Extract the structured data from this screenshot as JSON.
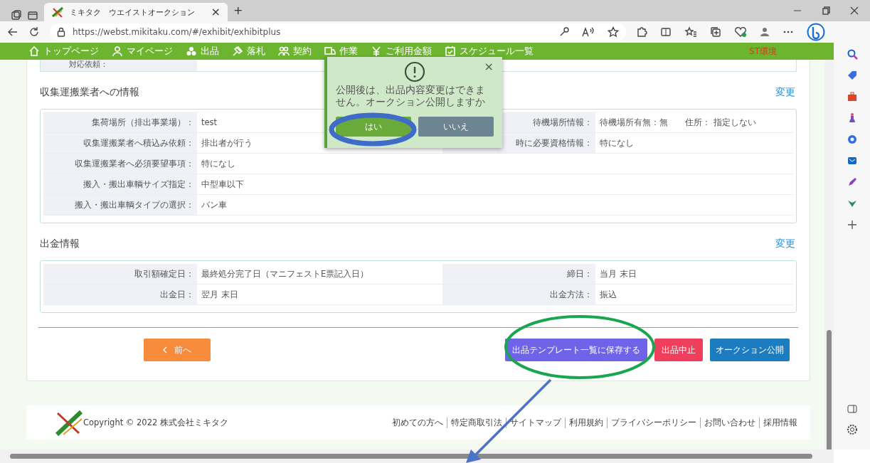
{
  "browser": {
    "tab_title": "ミキタク　ウエイストオークション",
    "tab_close": "×",
    "new_tab": "+",
    "url": "https://webst.mikitaku.com/#/exhibit/exhibitplus"
  },
  "nav": {
    "items": [
      {
        "label": "トップページ",
        "kind": "home"
      },
      {
        "label": "マイページ",
        "kind": "person"
      },
      {
        "label": "出品",
        "kind": "boxes"
      },
      {
        "label": "落札",
        "kind": "gavel"
      },
      {
        "label": "契約",
        "kind": "people"
      },
      {
        "label": "作業",
        "kind": "truck"
      },
      {
        "label": "ご利用金額",
        "kind": "yen"
      },
      {
        "label": "スケジュール一覧",
        "kind": "calendar"
      }
    ],
    "env_label": "ST環境"
  },
  "partial_row": {
    "label": "対応依頼："
  },
  "sections": [
    {
      "title": "収集運搬業者への情報",
      "edit": "変更",
      "rows": [
        [
          {
            "label": "集荷場所（排出事業場）：",
            "value": "test"
          },
          {
            "label": "待機場所情報：",
            "value": "待機場所有無：無　　住所： 指定しない"
          }
        ],
        [
          {
            "label": "収集運搬業者へ積込み依頼：",
            "value": "排出者が行う"
          },
          {
            "label": "時に必要資格情報：",
            "value": "特になし"
          }
        ],
        [
          {
            "label": "収集運搬業者へ必須要望事項：",
            "value": "特になし"
          }
        ],
        [
          {
            "label": "搬入・搬出車輌サイズ指定：",
            "value": "中型車以下"
          }
        ],
        [
          {
            "label": "搬入・搬出車輌タイプの選択：",
            "value": "バン車"
          }
        ]
      ]
    },
    {
      "title": "出金情報",
      "edit": "変更",
      "rows": [
        [
          {
            "label": "取引額確定日：",
            "value": "最終処分完了日（マニフェストE票記入日）"
          },
          {
            "label": "締日：",
            "value": "当月 末日"
          }
        ],
        [
          {
            "label": "出金日：",
            "value": "翌月 末日"
          },
          {
            "label": "出金方法：",
            "value": "振込"
          }
        ]
      ]
    }
  ],
  "actions": [
    {
      "label": "前へ",
      "kind": "back"
    },
    {
      "label": "出品テンプレート一覧に保存する",
      "kind": "save"
    },
    {
      "label": "出品中止",
      "kind": "stop"
    },
    {
      "label": "オークション公開",
      "kind": "publish"
    }
  ],
  "dialog": {
    "message": "公開後は、出品内容変更はできません。オークション公開しますか",
    "close": "×",
    "buttons": [
      {
        "label": "はい",
        "kind": "primary"
      },
      {
        "label": "いいえ",
        "kind": "secondary"
      }
    ]
  },
  "footer": {
    "copyright": "Copyright © 2022 株式会社ミキタク",
    "links": [
      "初めての方へ",
      "特定商取引法",
      "サイトマップ",
      "利用規約",
      "プライバシーポリシー",
      "お問い合わせ",
      "採用情報"
    ]
  }
}
